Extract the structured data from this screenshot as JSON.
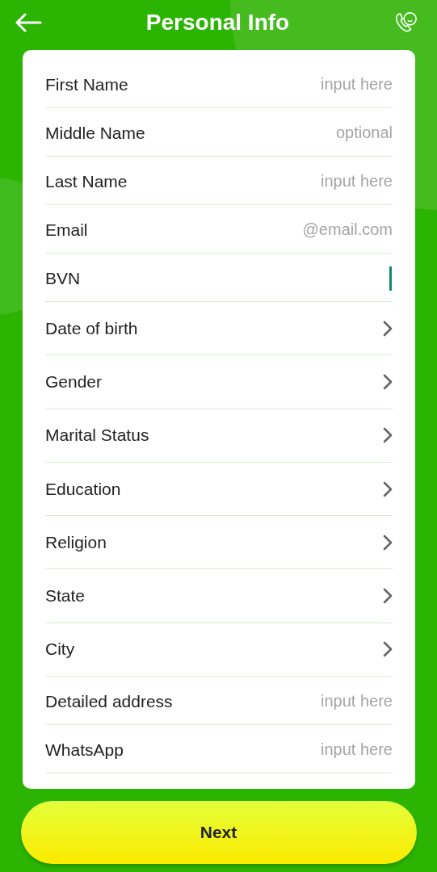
{
  "header": {
    "title": "Personal Info"
  },
  "fields": [
    {
      "kind": "input",
      "label": "First Name",
      "placeholder": "input here",
      "focused": false
    },
    {
      "kind": "input",
      "label": "Middle Name",
      "placeholder": "optional",
      "focused": false
    },
    {
      "kind": "input",
      "label": "Last Name",
      "placeholder": "input here",
      "focused": false
    },
    {
      "kind": "input",
      "label": "Email",
      "placeholder": "@email.com",
      "focused": false
    },
    {
      "kind": "input",
      "label": "BVN",
      "focused": true
    },
    {
      "kind": "select",
      "label": "Date of birth"
    },
    {
      "kind": "select",
      "label": "Gender"
    },
    {
      "kind": "select",
      "label": "Marital Status"
    },
    {
      "kind": "select",
      "label": "Education"
    },
    {
      "kind": "select",
      "label": "Religion"
    },
    {
      "kind": "select",
      "label": "State"
    },
    {
      "kind": "select",
      "label": "City"
    },
    {
      "kind": "input",
      "label": "Detailed address",
      "placeholder": "input here",
      "focused": false
    },
    {
      "kind": "input",
      "label": "WhatsApp",
      "placeholder": "input here",
      "focused": false
    }
  ],
  "next_button": "Next"
}
